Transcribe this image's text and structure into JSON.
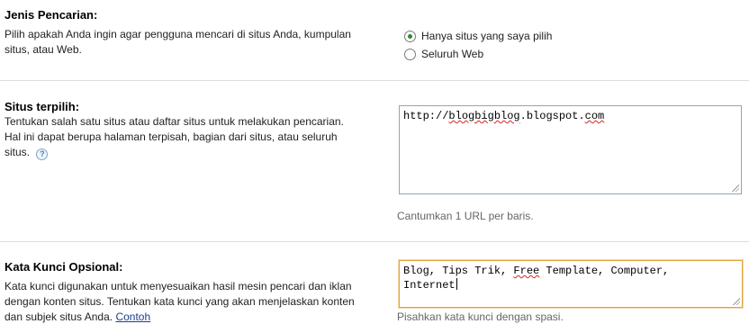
{
  "search_type": {
    "title": "Jenis Pencarian:",
    "description": "Pilih apakah Anda ingin agar pengguna mencari di situs Anda, kumpulan situs, atau Web.",
    "options": [
      {
        "label": "Hanya situs yang saya pilih",
        "checked": true
      },
      {
        "label": "Seluruh Web",
        "checked": false
      }
    ]
  },
  "selected_sites": {
    "title": "Situs terpilih:",
    "description": "Tentukan salah satu situs atau daftar situs untuk melakukan pencarian. Hal ini dapat berupa halaman terpisah, bagian dari situs, atau seluruh situs.",
    "help_icon": "help-question-icon",
    "help_glyph": "?",
    "url_prefix": "http://",
    "url_misspelled": "blogbigblog",
    "url_middle": ".blogspot.",
    "url_tld": "com",
    "hint": "Cantumkan 1 URL per baris."
  },
  "keywords": {
    "title": "Kata Kunci Opsional:",
    "description": "Kata kunci digunakan untuk menyesuaikan hasil mesin pencari dan iklan dengan konten situs. Tentukan kata kunci yang akan menjelaskan konten dan subjek situs Anda.",
    "example_link": "Contoh",
    "value_part1": "Blog, Tips Trik, ",
    "value_misspelled": "Free",
    "value_part2": " Template, Computer,",
    "value_line2": "Internet",
    "hint": "Pisahkan kata kunci dengan spasi."
  },
  "colors": {
    "divider": "#dcdcdc",
    "focus_border": "#e0a53b",
    "radio_checked": "#2f8c2f",
    "link": "#1a3e8c"
  }
}
